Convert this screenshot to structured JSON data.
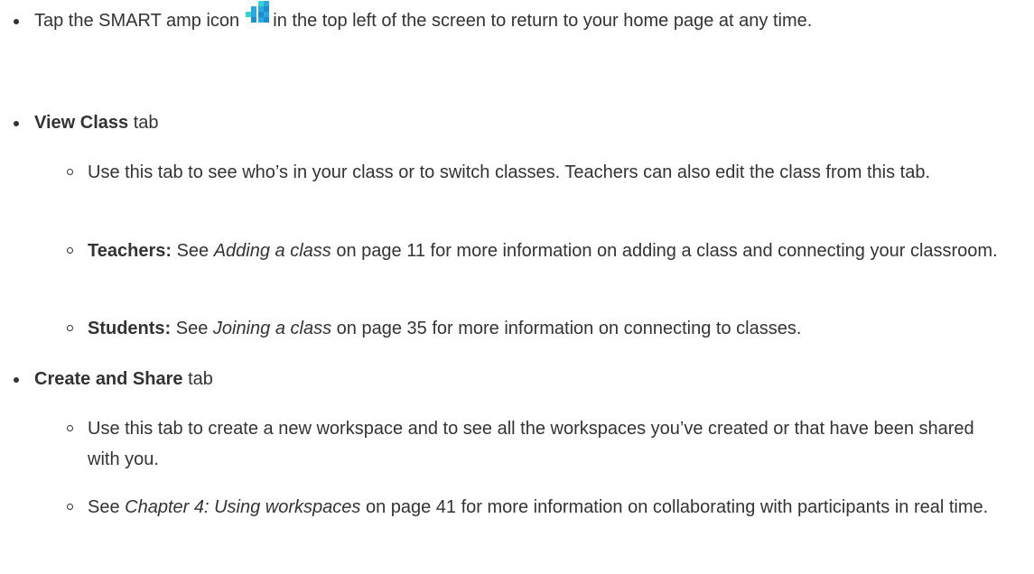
{
  "items": [
    {
      "type": "bullet",
      "segments": {
        "s0": "Tap the SMART amp icon ",
        "s1": " in the top left of the screen to return to your home page at any time."
      },
      "icon": "smart-amp-icon"
    },
    {
      "type": "bullet",
      "heading": "View Class",
      "suffix": " tab",
      "subitems": [
        {
          "text": "Use this tab to see who’s in your class or to switch classes. Teachers can also edit the class from this tab."
        },
        {
          "bold": "Teachers:",
          "pre": " See ",
          "link": "Adding a class",
          "post": " on page 11 for more information on adding a class and connecting your classroom."
        },
        {
          "bold": "Students:",
          "pre": " See ",
          "link": "Joining a class",
          "post": " on page 35 for more information on connecting to classes."
        }
      ]
    },
    {
      "type": "bullet",
      "heading": "Create and Share",
      "suffix": " tab",
      "subitems": [
        {
          "text": "Use this tab to create a new workspace and to see all the workspaces you’ve created or that have been shared with you."
        },
        {
          "pre": "See ",
          "link": "Chapter 4: Using workspaces",
          "post": " on page 41 for more information on collaborating with participants in real time."
        }
      ]
    }
  ],
  "colors": {
    "text": "#333333",
    "icon_blue": "#2aa9e0",
    "icon_teal": "#39d3d0"
  }
}
